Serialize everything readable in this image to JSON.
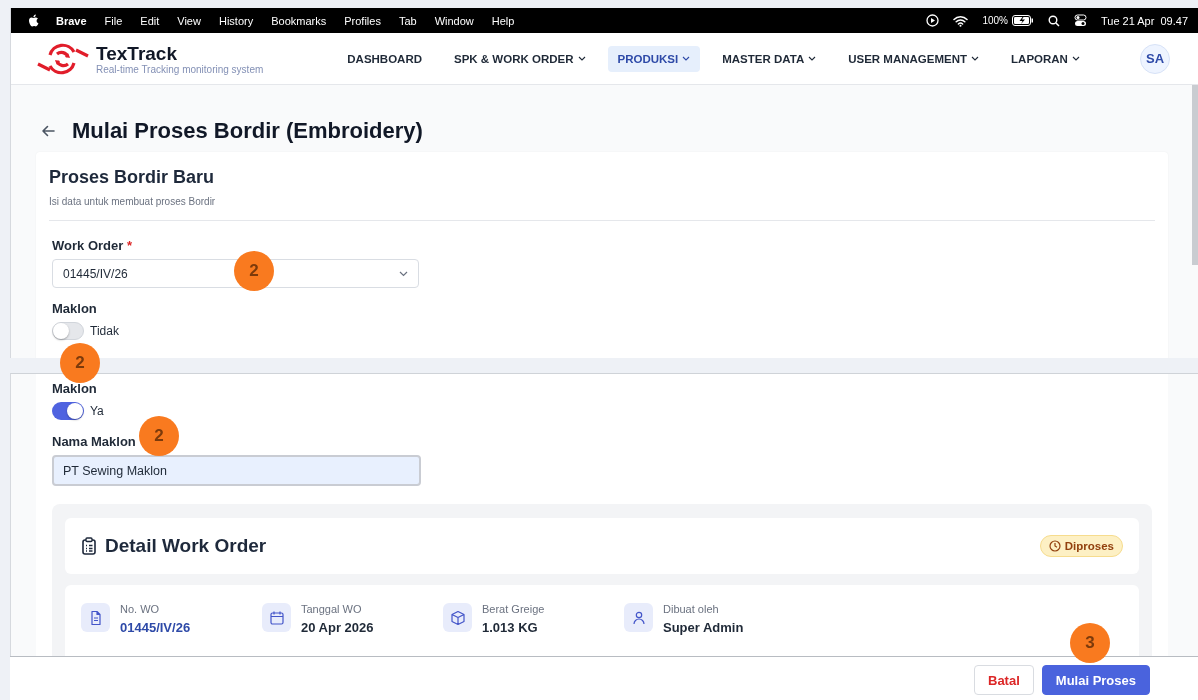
{
  "menubar": {
    "app": "Brave",
    "menus": [
      "File",
      "Edit",
      "View",
      "History",
      "Bookmarks",
      "Profiles",
      "Tab",
      "Window",
      "Help"
    ],
    "battery": "100%",
    "clock": "Tue 21 Apr  09.47"
  },
  "header": {
    "brand": "TexTrack",
    "tagline": "Real-time Tracking monitoring system",
    "avatar": "SA",
    "nav": [
      {
        "label": "DASHBOARD",
        "dropdown": false,
        "selected": false
      },
      {
        "label": "SPK & WORK ORDER",
        "dropdown": true,
        "selected": false
      },
      {
        "label": "PRODUKSI",
        "dropdown": true,
        "selected": true
      },
      {
        "label": "MASTER DATA",
        "dropdown": true,
        "selected": false
      },
      {
        "label": "USER MANAGEMENT",
        "dropdown": true,
        "selected": false
      },
      {
        "label": "LAPORAN",
        "dropdown": true,
        "selected": false
      }
    ]
  },
  "page_title": "Mulai Proses Bordir (Embroidery)",
  "form": {
    "title": "Proses Bordir Baru",
    "subtitle": "Isi data untuk membuat proses Bordir",
    "work_order": {
      "label": "Work Order",
      "required": "*",
      "value": "01445/IV/26"
    },
    "maklon": {
      "label": "Maklon",
      "on": false,
      "state_text": "Tidak"
    }
  },
  "form_after": {
    "maklon": {
      "label": "Maklon",
      "on": true,
      "state_text": "Ya"
    },
    "nama_maklon": {
      "label": "Nama Maklon",
      "value": "PT Sewing Maklon"
    },
    "detail": {
      "title": "Detail Work Order",
      "status": "Diproses",
      "fields": [
        {
          "kind": "document",
          "label": "No. WO",
          "value": "01445/IV/26",
          "link": true
        },
        {
          "kind": "calendar",
          "label": "Tanggal WO",
          "value": "20 Apr 2026",
          "link": false
        },
        {
          "kind": "box",
          "label": "Berat Greige",
          "value": "1.013 KG",
          "link": false
        },
        {
          "kind": "user",
          "label": "Dibuat oleh",
          "value": "Super Admin",
          "link": false
        }
      ]
    }
  },
  "actions": [
    {
      "label": "Batal",
      "kind": "cancel"
    },
    {
      "label": "Mulai Proses",
      "kind": "primary"
    }
  ],
  "step_badges": [
    {
      "number": "2"
    },
    {
      "number": "2"
    },
    {
      "number": "2"
    },
    {
      "number": "3"
    }
  ]
}
